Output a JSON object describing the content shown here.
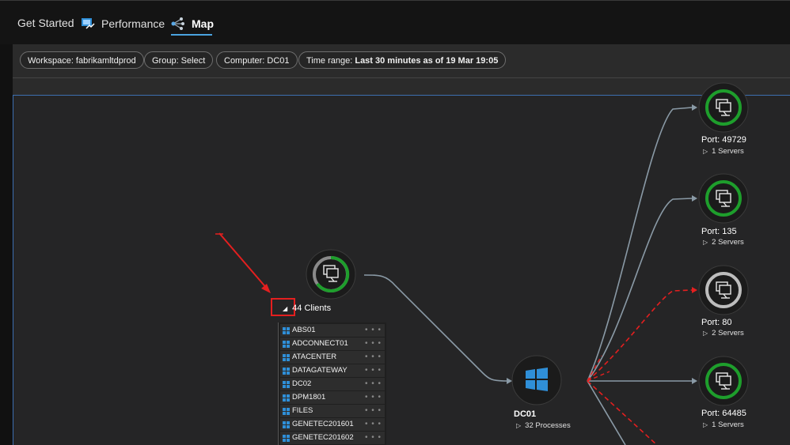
{
  "tabs": [
    {
      "label": "Get Started",
      "icon": "none"
    },
    {
      "label": "Performance",
      "icon": "performance-chart-icon"
    },
    {
      "label": "Map",
      "icon": "map-network-icon"
    }
  ],
  "filters": [
    {
      "prefix": "Workspace: fabrikamltdprod",
      "value": ""
    },
    {
      "prefix": "Group: Select",
      "value": ""
    },
    {
      "prefix": "Computer: DC01",
      "value": ""
    },
    {
      "prefix": "Time range: ",
      "value": "Last 30 minutes as of 19 Mar 19:05"
    }
  ],
  "clients": {
    "header": "44 Clients",
    "expand_glyph": "◢",
    "rows": [
      "ABS01",
      "ADCONNECT01",
      "ATACENTER",
      "DATAGATEWAY",
      "DC02",
      "DPM1801",
      "FILES",
      "GENETEC201601",
      "GENETEC201602"
    ],
    "dots": "• • •"
  },
  "center": {
    "name": "DC01",
    "sub": "32 Processes"
  },
  "ports": [
    {
      "label": "Port: 49729",
      "sub": "1 Servers",
      "ring": "green"
    },
    {
      "label": "Port: 135",
      "sub": "2 Servers",
      "ring": "green"
    },
    {
      "label": "Port: 80",
      "sub": "2 Servers",
      "ring": "grey"
    },
    {
      "label": "Port: 64485",
      "sub": "1 Servers",
      "ring": "green"
    }
  ],
  "colors": {
    "accent": "#4aa3df",
    "green_ring": "#1e9e2c",
    "grey_ring": "#bdbdbd",
    "failed_link": "#e41f1f",
    "link": "#8a9aa6",
    "windows_blue": "#2f8fd8"
  }
}
